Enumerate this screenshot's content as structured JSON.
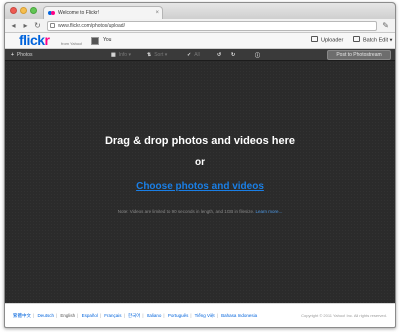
{
  "browser": {
    "tab_title": "Welcome to Flickr!",
    "url": "www.flickr.com/photos/upload/"
  },
  "header": {
    "logo_part1": "flick",
    "logo_part2": "r",
    "logo_sub": "from Yahoo!",
    "user_name": "You",
    "uploader_label": "Uploader",
    "batch_edit_label": "Batch Edit ▾"
  },
  "actionbar": {
    "add_photos": "Photos",
    "info": "Info ▾",
    "sort": "Sort ▾",
    "all": "All",
    "post_button": "Post to Photostream"
  },
  "drop_area": {
    "headline": "Drag & drop photos and videos here",
    "or": "or",
    "choose_link": "Choose photos and videos",
    "note": "Note: Videos are limited to 90 seconds in length, and 1GB in filesize.",
    "learn_more": "Learn more..."
  },
  "footer": {
    "languages": [
      "繁體中文",
      "Deutsch",
      "English",
      "Español",
      "Français",
      "한국어",
      "Italiano",
      "Português",
      "Tiếng Việt",
      "Bahasa Indonesia"
    ],
    "current_language": "English",
    "copyright": "Copyright © 2011 Yahoo! Inc. All rights reserved."
  }
}
